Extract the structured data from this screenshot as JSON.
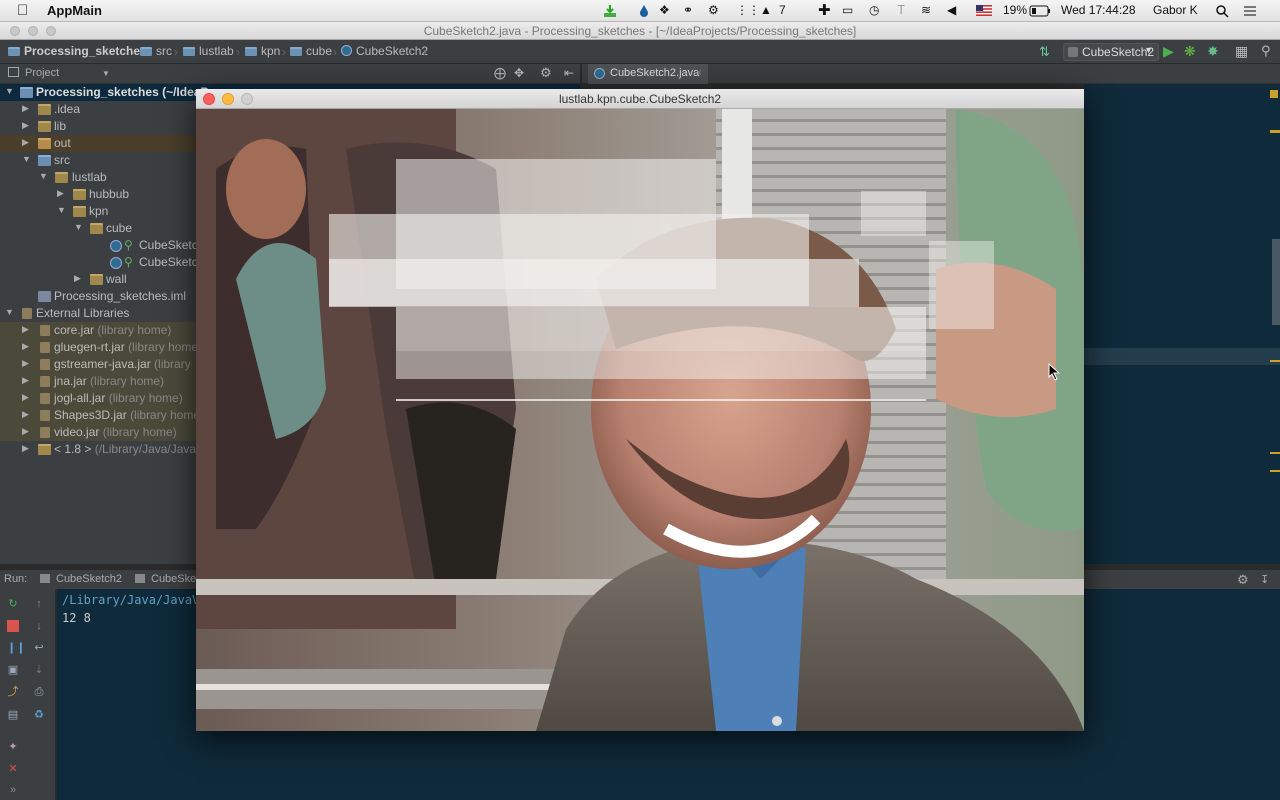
{
  "menubar": {
    "app_name": "AppMain",
    "notification_count": "7",
    "battery": "19%",
    "clock": "Wed 17:44:28",
    "user": "Gabor K"
  },
  "window": {
    "title": "CubeSketch2.java - Processing_sketches - [~/IdeaProjects/Processing_sketches]"
  },
  "breadcrumb": [
    "Processing_sketches",
    "src",
    "lustlab",
    "kpn",
    "cube",
    "CubeSketch2"
  ],
  "toolbar": {
    "run_config": "CubeSketch2"
  },
  "project_panel": {
    "header": "Project"
  },
  "editor_tab": {
    "label": "CubeSketch2.java"
  },
  "tree": {
    "root": "Processing_sketches",
    "root_path": "(~/IdeaP",
    "idea": ".idea",
    "lib": "lib",
    "out": "out",
    "src": "src",
    "lustlab": "lustlab",
    "hubbub": "hubbub",
    "kpn": "kpn",
    "cube": "cube",
    "cs1": "CubeSketch",
    "cs2": "CubeSketch",
    "wall": "wall",
    "iml": "Processing_sketches.iml",
    "ext": "External Libraries",
    "libs": [
      {
        "name": "core.jar",
        "note": "(library home)"
      },
      {
        "name": "gluegen-rt.jar",
        "note": "(library home"
      },
      {
        "name": "gstreamer-java.jar",
        "note": "(library"
      },
      {
        "name": "jna.jar",
        "note": "(library home)"
      },
      {
        "name": "jogl-all.jar",
        "note": "(library home)"
      },
      {
        "name": "Shapes3D.jar",
        "note": "(library home"
      },
      {
        "name": "video.jar",
        "note": "(library home)"
      }
    ],
    "jdk": "< 1.8 >",
    "jdk_path": "(/Library/Java/Java"
  },
  "run_panel": {
    "label": "Run:",
    "tab1": "CubeSketch2",
    "tab2": "CubeSket"
  },
  "console": {
    "line1": "/Library/Java/JavaV",
    "line2": "12 8"
  },
  "sketch_window": {
    "title": "lustlab.kpn.cube.CubeSketch2"
  }
}
